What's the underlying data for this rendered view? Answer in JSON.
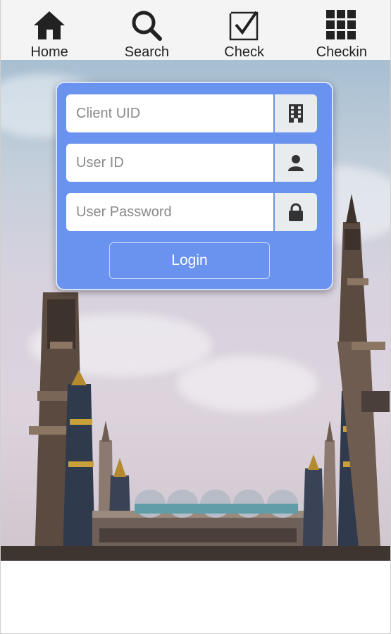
{
  "nav": {
    "items": [
      {
        "label": "Home",
        "icon": "home-icon"
      },
      {
        "label": "Search",
        "icon": "search-icon"
      },
      {
        "label": "Check",
        "icon": "checkbox-icon"
      },
      {
        "label": "Checkin",
        "icon": "grid-icon"
      }
    ]
  },
  "login": {
    "client_uid_placeholder": "Client UID",
    "client_uid_icon": "building-icon",
    "user_id_placeholder": "User ID",
    "user_id_icon": "user-icon",
    "password_placeholder": "User Password",
    "password_icon": "lock-icon",
    "button_label": "Login"
  },
  "colors": {
    "card": "#6993ee",
    "navbar": "#f4f4f4",
    "addon": "#e9ecef"
  }
}
